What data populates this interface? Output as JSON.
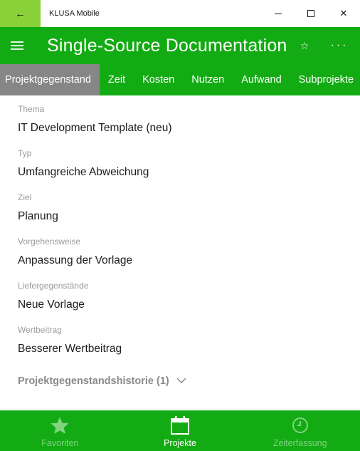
{
  "window": {
    "title": "KLUSA Mobile",
    "back_glyph": "←",
    "minimize_glyph": "—",
    "maximize_glyph": "☐",
    "close_glyph": "✕"
  },
  "appbar": {
    "title": "Single-Source Documentation",
    "star_glyph": "☆",
    "more_glyph": "···"
  },
  "tabs": [
    {
      "label": "Projektgegenstand",
      "active": true
    },
    {
      "label": "Zeit",
      "active": false
    },
    {
      "label": "Kosten",
      "active": false
    },
    {
      "label": "Nutzen",
      "active": false
    },
    {
      "label": "Aufwand",
      "active": false
    },
    {
      "label": "Subprojekte",
      "active": false
    }
  ],
  "fields": [
    {
      "label": "Thema",
      "value": "IT Development Template (neu)"
    },
    {
      "label": "Typ",
      "value": "Umfangreiche Abweichung"
    },
    {
      "label": "Ziel",
      "value": "Planung"
    },
    {
      "label": "Vorgehensweise",
      "value": "Anpassung der Vorlage"
    },
    {
      "label": "Liefergegenstände",
      "value": "Neue Vorlage"
    },
    {
      "label": "Wertbeitrag",
      "value": "Besserer Wertbeitrag"
    }
  ],
  "history": {
    "label": "Projektgegenstandshistorie (1)"
  },
  "bottombar": {
    "items": [
      {
        "label": "Favoriten",
        "icon": "star-icon",
        "active": false
      },
      {
        "label": "Projekte",
        "icon": "calendar-icon",
        "active": true
      },
      {
        "label": "Zeiterfassung",
        "icon": "clock-icon",
        "active": false
      }
    ]
  },
  "colors": {
    "accent_green": "#13ab13",
    "back_button_green": "#8bd139",
    "active_tab_gray": "#868686",
    "inactive_nav_label": "#7fd47f"
  }
}
